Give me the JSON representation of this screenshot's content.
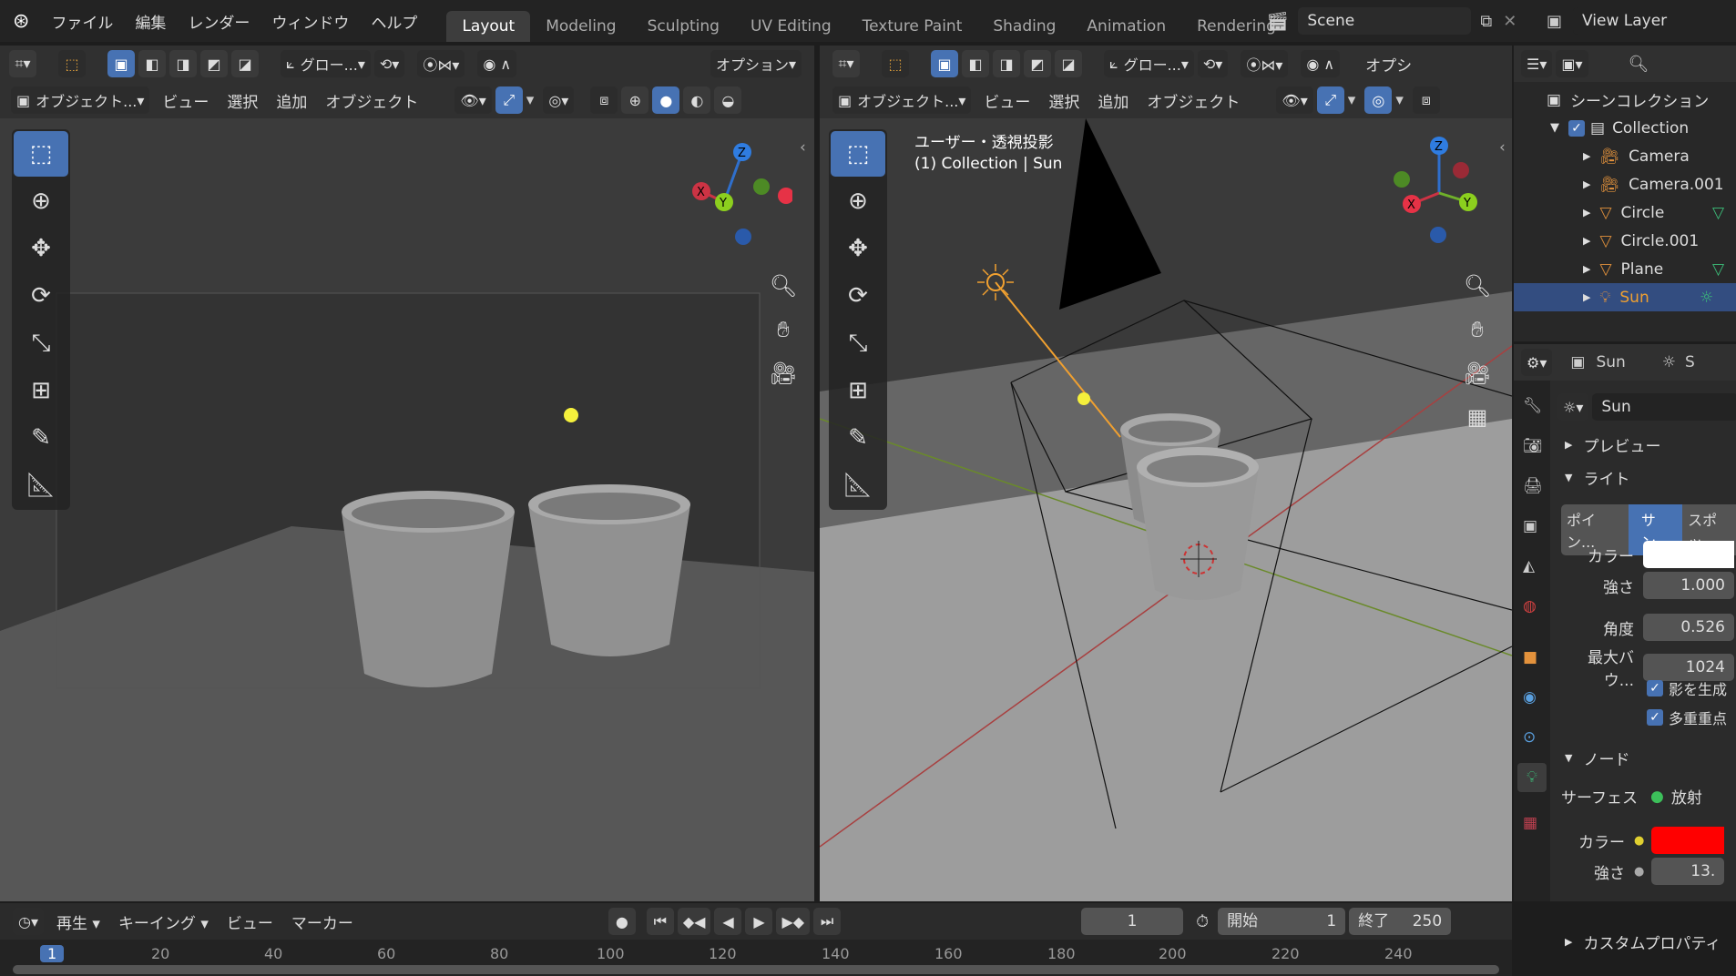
{
  "menu": {
    "logo": "blender-icon",
    "items": [
      "ファイル",
      "編集",
      "レンダー",
      "ウィンドウ",
      "ヘルプ"
    ]
  },
  "workspaces": [
    "Layout",
    "Modeling",
    "Sculpting",
    "UV Editing",
    "Texture Paint",
    "Shading",
    "Animation",
    "Rendering"
  ],
  "active_workspace": "Layout",
  "scene": {
    "name": "Scene"
  },
  "view_layer": {
    "name": "View Layer"
  },
  "left_view": {
    "transform_orientation": "グロー...",
    "options_label": "オプション",
    "mode": "オブジェクト...",
    "menus": [
      "ビュー",
      "選択",
      "追加",
      "オブジェクト"
    ]
  },
  "right_view": {
    "transform_orientation": "グロー...",
    "options_label": "オプシ",
    "mode": "オブジェクト...",
    "menus": [
      "ビュー",
      "選択",
      "追加",
      "オブジェクト"
    ],
    "overlay_title": "ユーザー・透視投影",
    "overlay_subtitle": "(1) Collection | Sun"
  },
  "gizmo": {
    "x": "X",
    "y": "Y",
    "z": "Z"
  },
  "outliner": {
    "root": "シーンコレクション",
    "collection": "Collection",
    "items": [
      {
        "name": "Camera",
        "type": "camera"
      },
      {
        "name": "Camera.001",
        "type": "camera"
      },
      {
        "name": "Circle",
        "type": "mesh"
      },
      {
        "name": "Circle.001",
        "type": "mesh"
      },
      {
        "name": "Plane",
        "type": "mesh"
      },
      {
        "name": "Sun",
        "type": "light",
        "selected": true
      }
    ]
  },
  "properties": {
    "object_name": "Sun",
    "object_name2": "S",
    "data_name": "Sun",
    "preview": "プレビュー",
    "light": "ライト",
    "light_types": [
      "ポイン...",
      "サン",
      "スポッ"
    ],
    "active_light_type": "サン",
    "color_label": "カラー",
    "strength_label": "強さ",
    "strength": "1.000",
    "angle_label": "角度",
    "angle": "0.526",
    "max_bounce_label": "最大バウ...",
    "max_bounce": "1024",
    "cast_shadow": "影を生成",
    "multiple_importance": "多重重点",
    "nodes": "ノード",
    "surface_label": "サーフェス",
    "surface_value": "放射",
    "node_color_label": "カラー",
    "node_strength_label": "強さ",
    "node_strength": "13.",
    "custom_props": "カスタムプロパティ",
    "emission_color": "#ff0000"
  },
  "timeline": {
    "menus": [
      "再生",
      "キーイング",
      "ビュー",
      "マーカー"
    ],
    "current_frame": "1",
    "start_label": "開始",
    "start": "1",
    "end_label": "終了",
    "end": "250",
    "ticks": [
      "1",
      "20",
      "40",
      "60",
      "80",
      "100",
      "120",
      "140",
      "160",
      "180",
      "200",
      "220",
      "240"
    ]
  }
}
